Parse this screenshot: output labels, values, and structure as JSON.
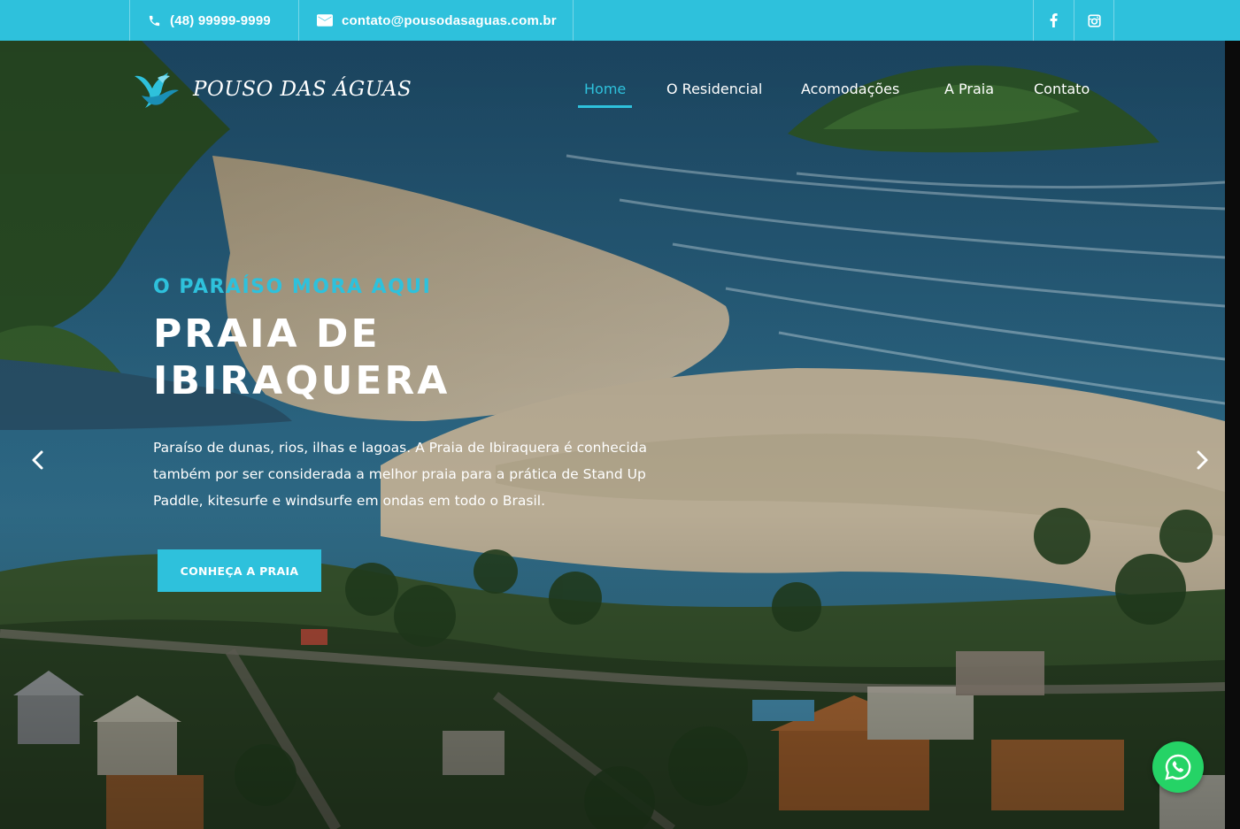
{
  "topbar": {
    "phone": "(48) 99999-9999",
    "email": "contato@pousodasaguas.com.br",
    "social": [
      {
        "icon": "facebook-icon"
      },
      {
        "icon": "instagram-icon"
      }
    ]
  },
  "brand": {
    "name": "POUSO DAS ÁGUAS",
    "logo_icon": "bird-wave-icon"
  },
  "nav": {
    "items": [
      {
        "label": "Home",
        "active": true
      },
      {
        "label": "O Residencial",
        "active": false
      },
      {
        "label": "Acomodações",
        "active": false
      },
      {
        "label": "A Praia",
        "active": false
      },
      {
        "label": "Contato",
        "active": false
      }
    ]
  },
  "slide": {
    "kicker": "O PARAÍSO MORA AQUI",
    "title_line1": "PRAIA DE",
    "title_line2": "IBIRAQUERA",
    "description": "Paraíso de dunas, rios, ilhas e lagoas. A Praia de Ibiraquera é conhecida também por ser considerada a melhor praia para a prática de Stand Up Paddle, kitesurfe e windsurfe em ondas em todo o Brasil.",
    "cta_label": "CONHEÇA A PRAIA",
    "prev_icon": "chevron-left-icon",
    "next_icon": "chevron-right-icon"
  },
  "floating": {
    "icon": "whatsapp-icon"
  },
  "colors": {
    "accent": "#2ec1dc",
    "whatsapp": "#25d366",
    "text": "#ffffff"
  }
}
